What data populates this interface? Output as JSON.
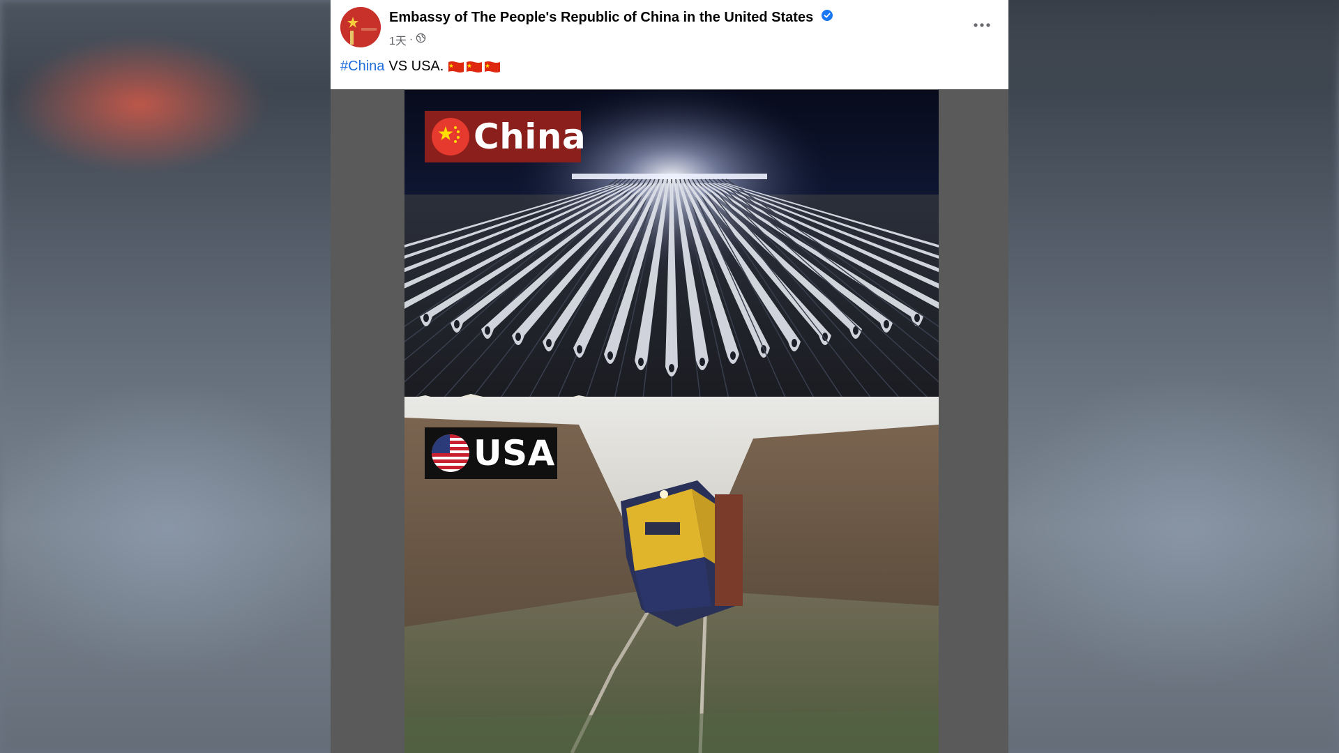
{
  "post": {
    "page_name": "Embassy of The People's Republic of China in the United States",
    "timestamp": "1天",
    "separator": "·",
    "text_hashtag": "#China",
    "text_body": "VS USA.",
    "text_flags": [
      "🇨🇳",
      "🇨🇳",
      "🇨🇳"
    ],
    "more_icon": "more-horizontal-icon",
    "verified_icon": "verified-badge-icon",
    "privacy_icon": "globe-icon"
  },
  "image": {
    "top_label": "China",
    "bottom_label": "USA"
  },
  "colors": {
    "hashtag": "#216fdb",
    "verified": "#1877f2",
    "china_badge": "#8b1f1c",
    "usa_badge": "#101010"
  }
}
